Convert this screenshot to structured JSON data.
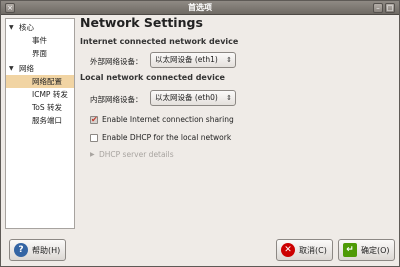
{
  "window": {
    "title": "首选项"
  },
  "sidebar": {
    "groups": [
      {
        "label": "核心",
        "items": [
          "事件",
          "界面"
        ]
      },
      {
        "label": "网络",
        "items": [
          "网络配置",
          "ICMP 转发",
          "ToS 转发",
          "服务端口"
        ]
      }
    ],
    "selected": "网络配置"
  },
  "main": {
    "title": "Network Settings",
    "internet_section": {
      "heading": "Internet connected network device",
      "label": "外部网络设备：",
      "value": "以太网设备 (eth1)"
    },
    "local_section": {
      "heading": "Local network connected device",
      "label": "内部网络设备：",
      "value": "以太网设备 (eth0)"
    },
    "enable_sharing": {
      "label": "Enable Internet connection sharing",
      "checked": true
    },
    "enable_dhcp": {
      "label": "Enable DHCP for the local network",
      "checked": false
    },
    "dhcp_details": {
      "label": "DHCP server details"
    }
  },
  "buttons": {
    "help": "帮助(H)",
    "cancel": "取消(C)",
    "ok": "确定(O)"
  },
  "icons": {
    "close": "close-icon",
    "help": "help-icon",
    "cancel": "cancel-icon",
    "ok": "ok-icon"
  }
}
